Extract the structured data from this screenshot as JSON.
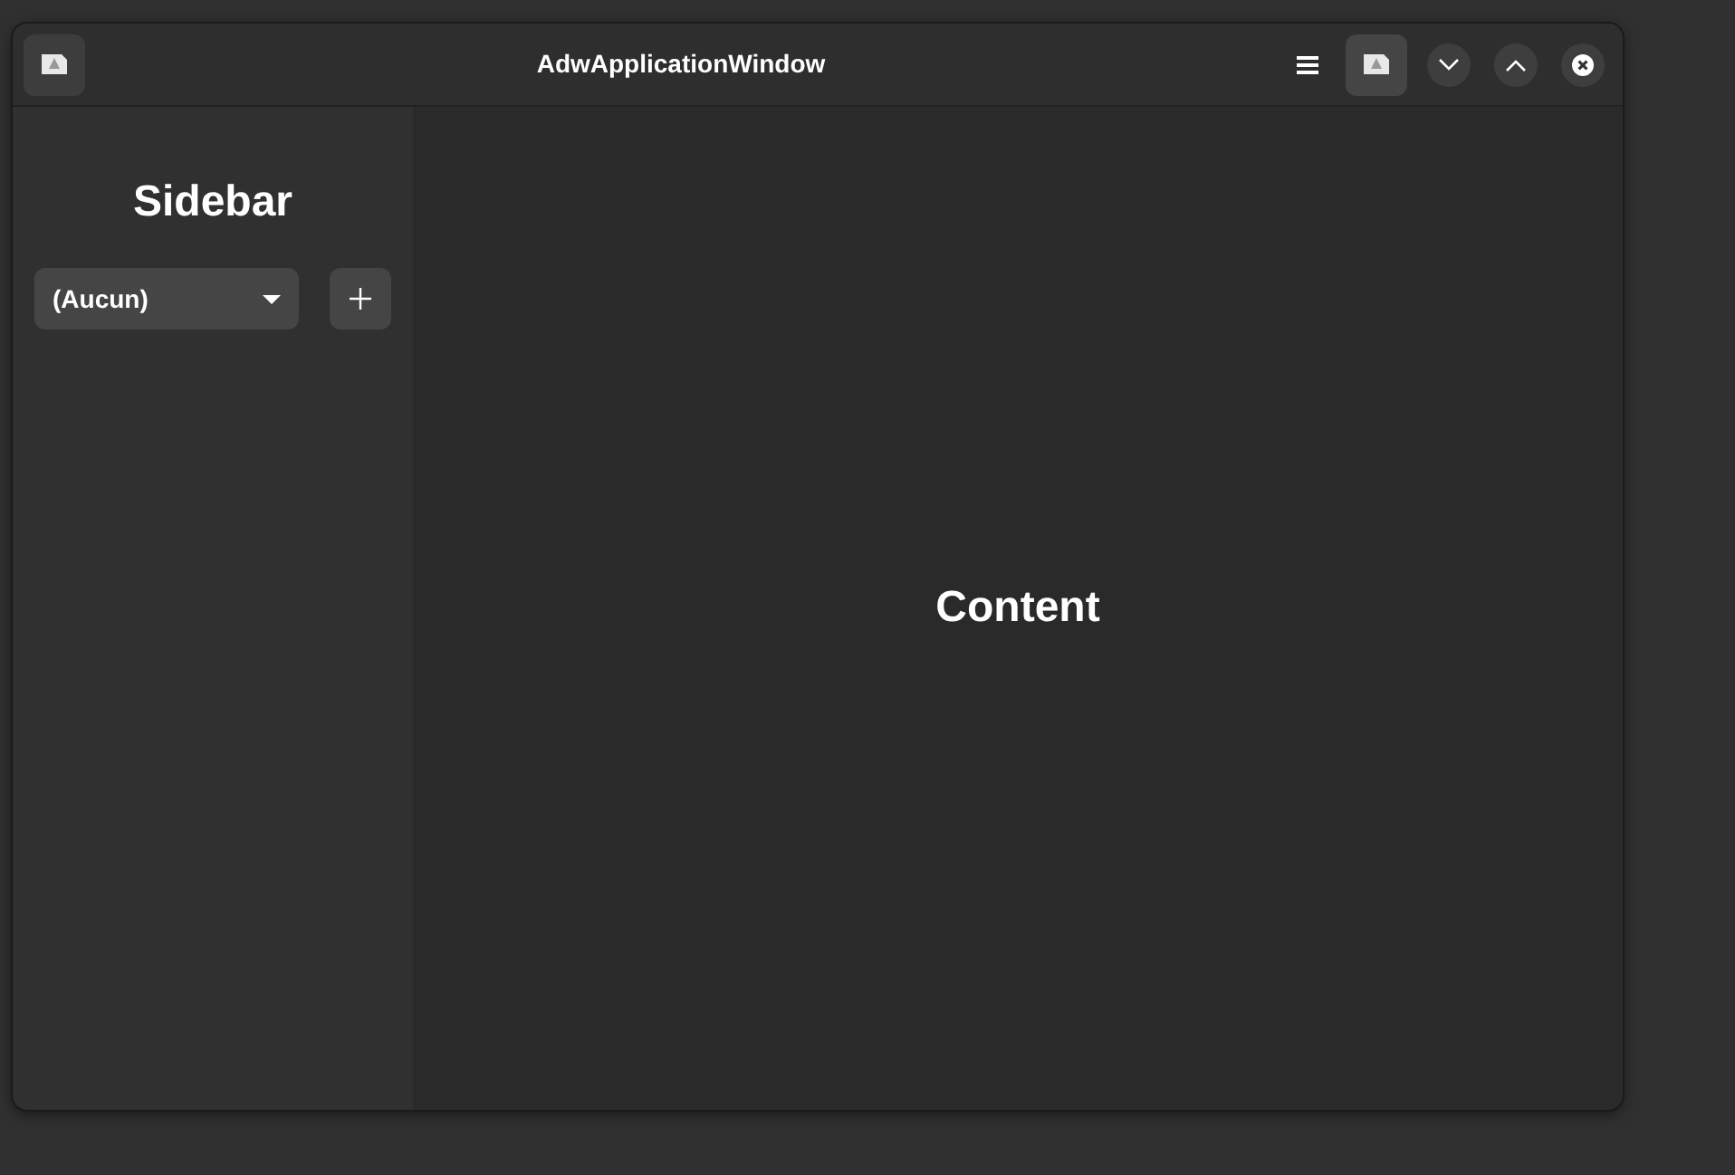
{
  "window": {
    "title": "AdwApplicationWindow"
  },
  "sidebar": {
    "title": "Sidebar",
    "dropdown": {
      "value": "(Aucun)"
    }
  },
  "content": {
    "title": "Content"
  }
}
